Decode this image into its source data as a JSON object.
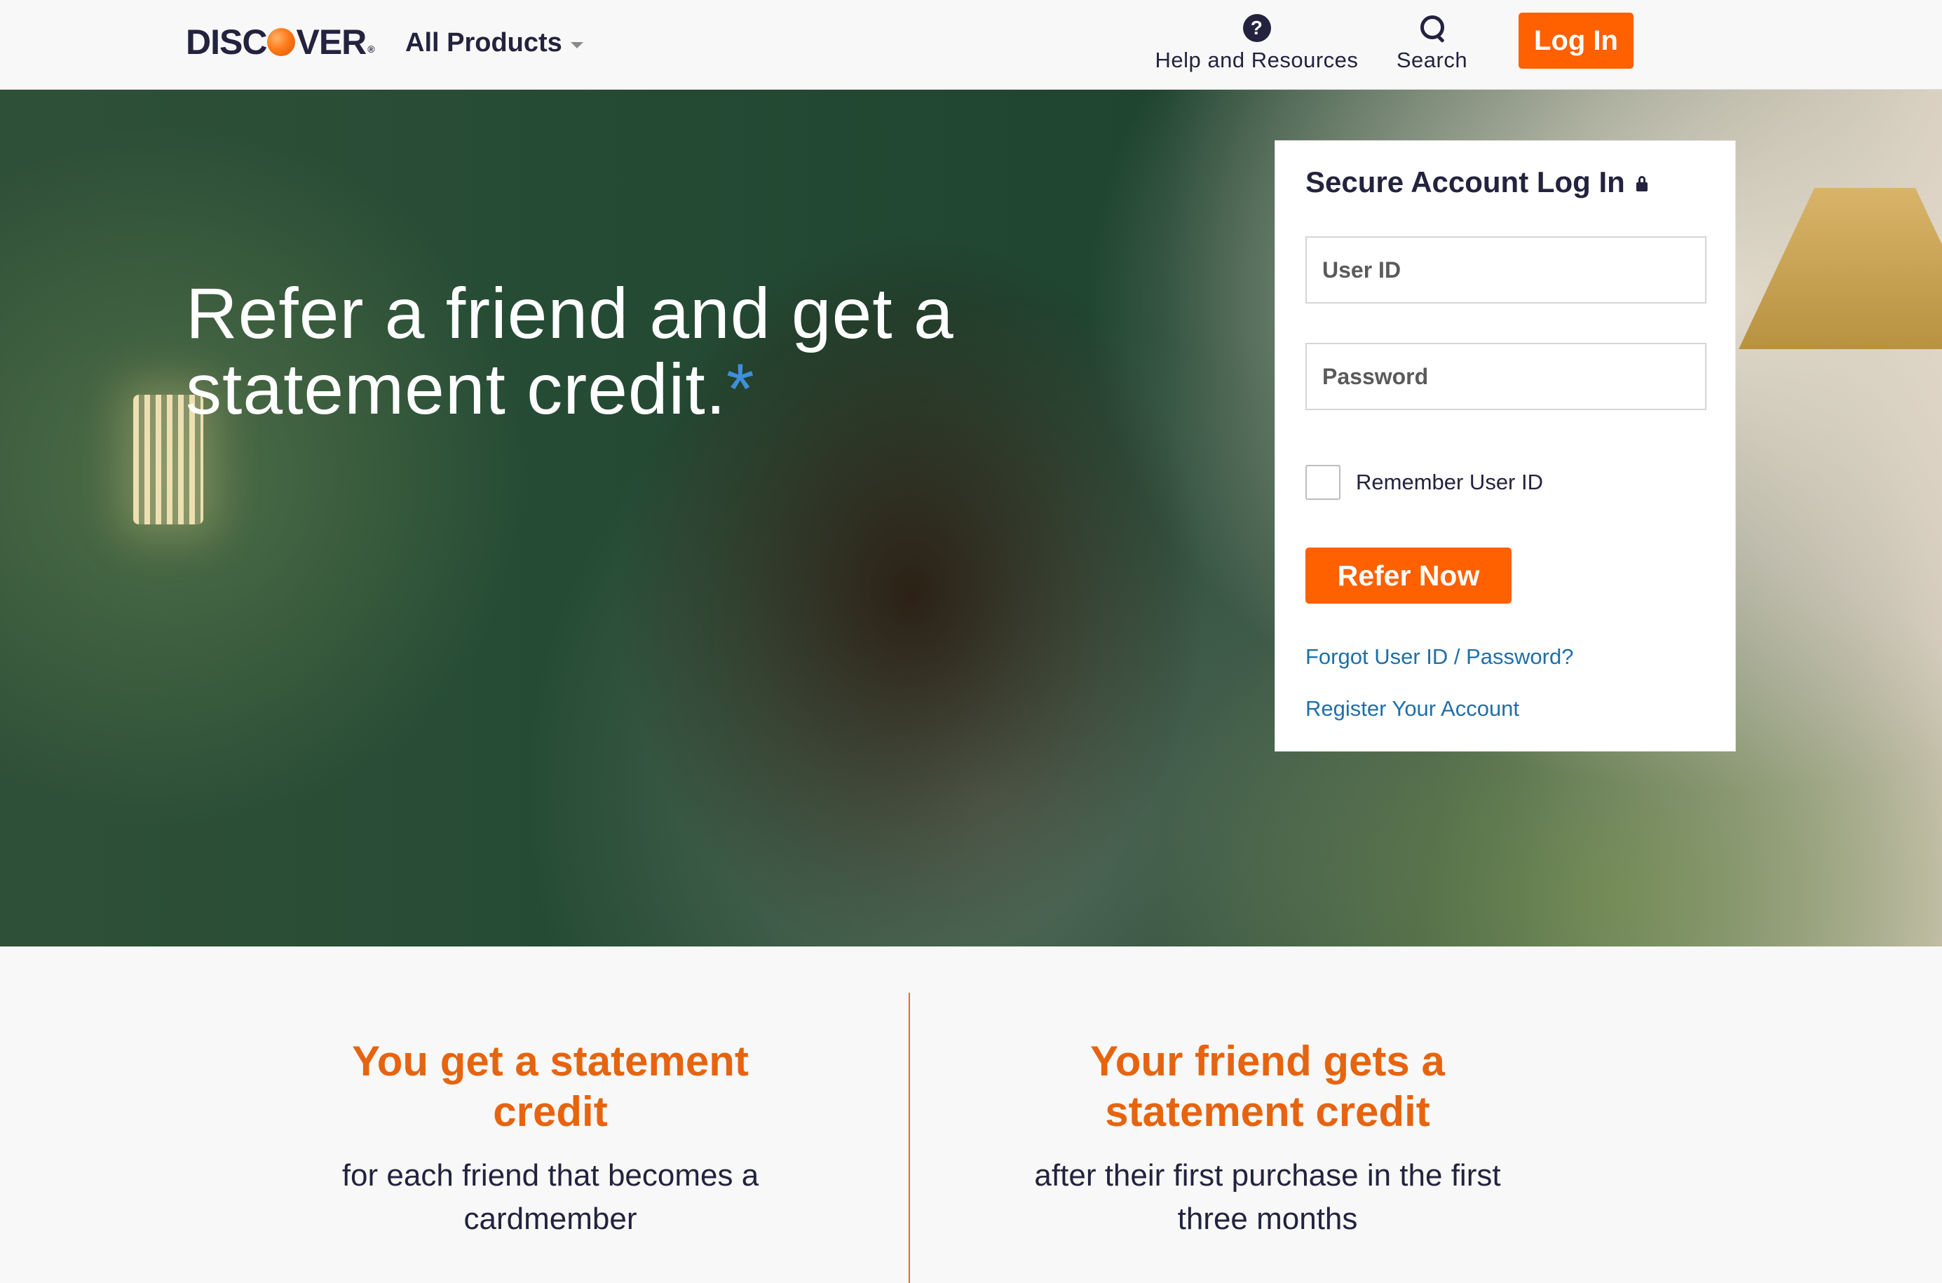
{
  "header": {
    "logo_text_left": "DISC",
    "logo_text_right": "VER",
    "all_products_label": "All Products",
    "help_label": "Help and Resources",
    "help_icon_glyph": "?",
    "search_label": "Search",
    "login_label": "Log In"
  },
  "hero": {
    "title": "Refer a friend and get a statement credit.",
    "asterisk": "*"
  },
  "login_card": {
    "title": "Secure Account Log In",
    "user_id_placeholder": "User ID",
    "password_placeholder": "Password",
    "remember_label": "Remember User ID",
    "remember_checked": false,
    "submit_label": "Refer Now",
    "forgot_link": "Forgot User ID / Password?",
    "register_link": "Register Your Account"
  },
  "benefits": [
    {
      "heading": "You get a statement credit",
      "body": "for each friend that becomes a cardmember"
    },
    {
      "heading": "Your friend gets a statement credit",
      "body": "after their first purchase in the first three months"
    }
  ],
  "colors": {
    "brand_orange": "#ff6000",
    "heading_orange": "#e6640f",
    "link_blue": "#1f6fa8",
    "text_dark": "#23233f"
  },
  "icons": {
    "help": "help-icon",
    "search": "search-icon",
    "lock": "lock-icon",
    "dropdown": "chevron-down-icon"
  }
}
